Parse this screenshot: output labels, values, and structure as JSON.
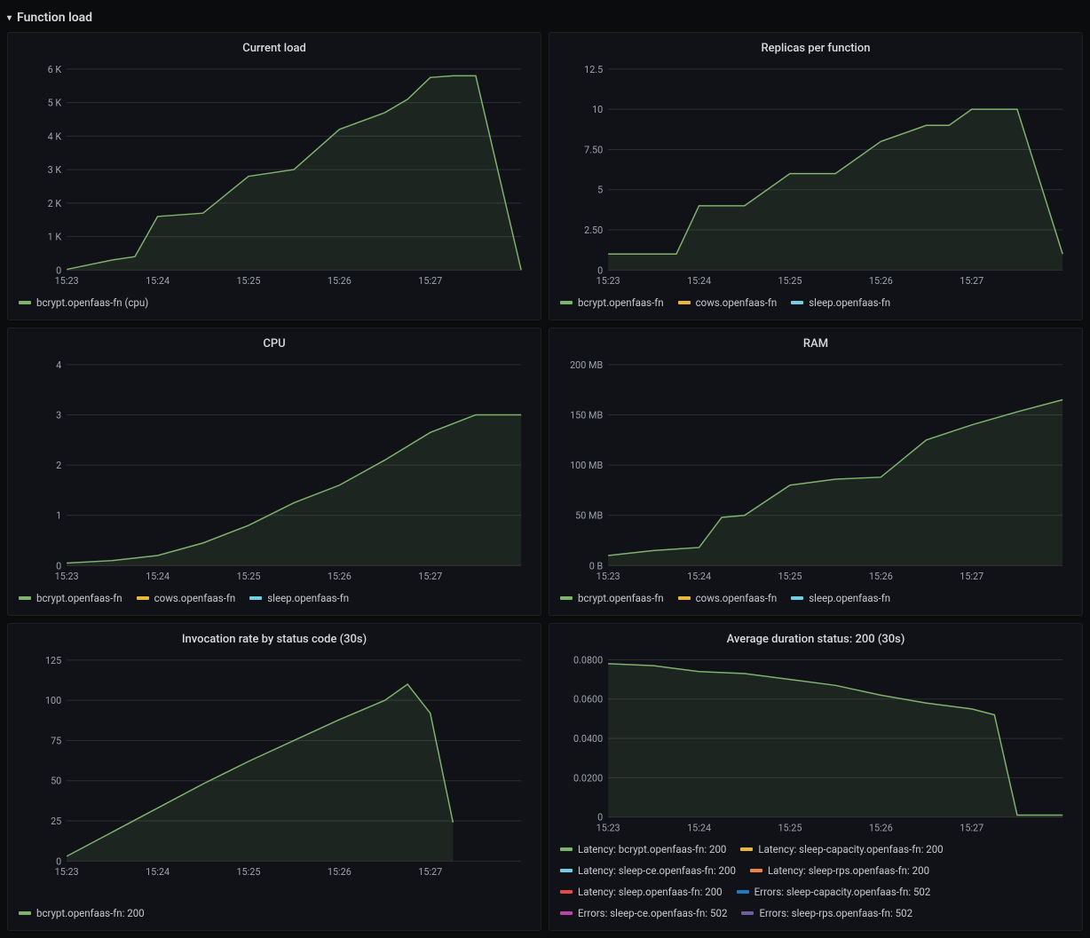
{
  "section": {
    "title": "Function load"
  },
  "colors": {
    "green": "#7eb26d",
    "yellow": "#eab839",
    "cyan": "#6ed0e0",
    "orange": "#ef843c",
    "red": "#e24d42",
    "blue": "#1f78c1",
    "pink": "#ba43a9",
    "purple": "#705da0"
  },
  "x_axis_common": {
    "times_seconds": [
      0,
      60,
      120,
      180,
      240,
      300
    ],
    "tick_positions_seconds": [
      0,
      60,
      120,
      180,
      240
    ],
    "tick_labels": [
      "15:23",
      "15:24",
      "15:25",
      "15:26",
      "15:27"
    ]
  },
  "chart_data": [
    {
      "id": "current_load",
      "title": "Current load",
      "type": "area",
      "x": [
        0,
        30,
        45,
        60,
        75,
        90,
        120,
        150,
        180,
        210,
        225,
        240,
        255,
        270,
        300
      ],
      "ylim": [
        0,
        6000
      ],
      "yticks": [
        0,
        1000,
        2000,
        3000,
        4000,
        5000,
        6000
      ],
      "ytick_labels": [
        "0",
        "1 K",
        "2 K",
        "3 K",
        "4 K",
        "5 K",
        "6 K"
      ],
      "series": [
        {
          "name": "bcrypt.openfaas-fn (cpu)",
          "color": "green",
          "values": [
            20,
            300,
            400,
            1600,
            1650,
            1700,
            2800,
            3000,
            4200,
            4700,
            5100,
            5750,
            5800,
            5800,
            0
          ]
        }
      ]
    },
    {
      "id": "replicas",
      "title": "Replicas per function",
      "type": "area",
      "x": [
        0,
        30,
        45,
        60,
        75,
        90,
        120,
        150,
        180,
        210,
        225,
        240,
        255,
        270,
        300
      ],
      "ylim": [
        0,
        12.5
      ],
      "yticks": [
        0,
        2.5,
        5,
        7.5,
        10,
        12.5
      ],
      "ytick_labels": [
        "0",
        "2.50",
        "5",
        "7.50",
        "10",
        "12.5"
      ],
      "series": [
        {
          "name": "bcrypt.openfaas-fn",
          "color": "green",
          "values": [
            1,
            1,
            1,
            4,
            4,
            4,
            6,
            6,
            8,
            9,
            9,
            10,
            10,
            10,
            1
          ]
        },
        {
          "name": "cows.openfaas-fn",
          "color": "yellow",
          "values": null
        },
        {
          "name": "sleep.openfaas-fn",
          "color": "cyan",
          "values": null
        }
      ]
    },
    {
      "id": "cpu",
      "title": "CPU",
      "type": "area",
      "x": [
        0,
        30,
        60,
        90,
        120,
        150,
        180,
        210,
        240,
        270,
        300
      ],
      "ylim": [
        0,
        4
      ],
      "yticks": [
        0,
        1,
        2,
        3,
        4
      ],
      "ytick_labels": [
        "0",
        "1",
        "2",
        "3",
        "4"
      ],
      "series": [
        {
          "name": "bcrypt.openfaas-fn",
          "color": "green",
          "values": [
            0.05,
            0.1,
            0.2,
            0.45,
            0.8,
            1.25,
            1.6,
            2.1,
            2.65,
            3.0,
            3.0
          ]
        },
        {
          "name": "cows.openfaas-fn",
          "color": "yellow",
          "values": null
        },
        {
          "name": "sleep.openfaas-fn",
          "color": "cyan",
          "values": null
        }
      ]
    },
    {
      "id": "ram",
      "title": "RAM",
      "type": "area",
      "x": [
        0,
        30,
        60,
        75,
        90,
        120,
        150,
        180,
        210,
        240,
        270,
        300
      ],
      "ylim": [
        0,
        200
      ],
      "yticks": [
        0,
        50,
        100,
        150,
        200
      ],
      "ytick_labels": [
        "0 B",
        "50 MB",
        "100 MB",
        "150 MB",
        "200 MB"
      ],
      "series": [
        {
          "name": "bcrypt.openfaas-fn",
          "color": "green",
          "values": [
            10,
            15,
            18,
            48,
            50,
            80,
            86,
            88,
            125,
            140,
            153,
            165
          ]
        },
        {
          "name": "cows.openfaas-fn",
          "color": "yellow",
          "values": null
        },
        {
          "name": "sleep.openfaas-fn",
          "color": "cyan",
          "values": null
        }
      ]
    },
    {
      "id": "invocation_rate",
      "title": "Invocation rate by status code (30s)",
      "type": "area",
      "x": [
        0,
        30,
        60,
        90,
        120,
        150,
        180,
        210,
        225,
        240,
        255
      ],
      "ylim": [
        0,
        125
      ],
      "yticks": [
        0,
        25,
        50,
        75,
        100,
        125
      ],
      "ytick_labels": [
        "0",
        "25",
        "50",
        "75",
        "100",
        "125"
      ],
      "series": [
        {
          "name": "bcrypt.openfaas-fn: 200",
          "color": "green",
          "values": [
            3,
            18,
            33,
            48,
            62,
            75,
            88,
            100,
            110,
            92,
            24
          ]
        }
      ]
    },
    {
      "id": "avg_duration",
      "title": "Average duration status: 200 (30s)",
      "type": "area",
      "x": [
        0,
        30,
        60,
        90,
        120,
        150,
        180,
        210,
        240,
        255,
        270,
        300
      ],
      "ylim": [
        0,
        0.08
      ],
      "yticks": [
        0,
        0.02,
        0.04,
        0.06,
        0.08
      ],
      "ytick_labels": [
        "0",
        "0.0200",
        "0.0400",
        "0.0600",
        "0.0800"
      ],
      "series": [
        {
          "name": "Latency: bcrypt.openfaas-fn: 200",
          "color": "green",
          "values": [
            0.078,
            0.077,
            0.074,
            0.073,
            0.07,
            0.067,
            0.062,
            0.058,
            0.055,
            0.052,
            0.001,
            0.001
          ]
        },
        {
          "name": "Latency: sleep-capacity.openfaas-fn: 200",
          "color": "yellow",
          "values": null
        },
        {
          "name": "Latency: sleep-ce.openfaas-fn: 200",
          "color": "cyan",
          "values": null
        },
        {
          "name": "Latency: sleep-rps.openfaas-fn: 200",
          "color": "orange",
          "values": null
        },
        {
          "name": "Latency: sleep.openfaas-fn: 200",
          "color": "red",
          "values": null
        },
        {
          "name": "Errors: sleep-capacity.openfaas-fn: 502",
          "color": "blue",
          "values": null
        },
        {
          "name": "Errors: sleep-ce.openfaas-fn: 502",
          "color": "pink",
          "values": null
        },
        {
          "name": "Errors: sleep-rps.openfaas-fn: 502",
          "color": "purple",
          "values": null
        }
      ]
    }
  ],
  "panel_heights": {
    "current_load": 230,
    "replicas": 230,
    "cpu": 230,
    "ram": 230,
    "invocation_rate": 230,
    "avg_duration": 180
  }
}
